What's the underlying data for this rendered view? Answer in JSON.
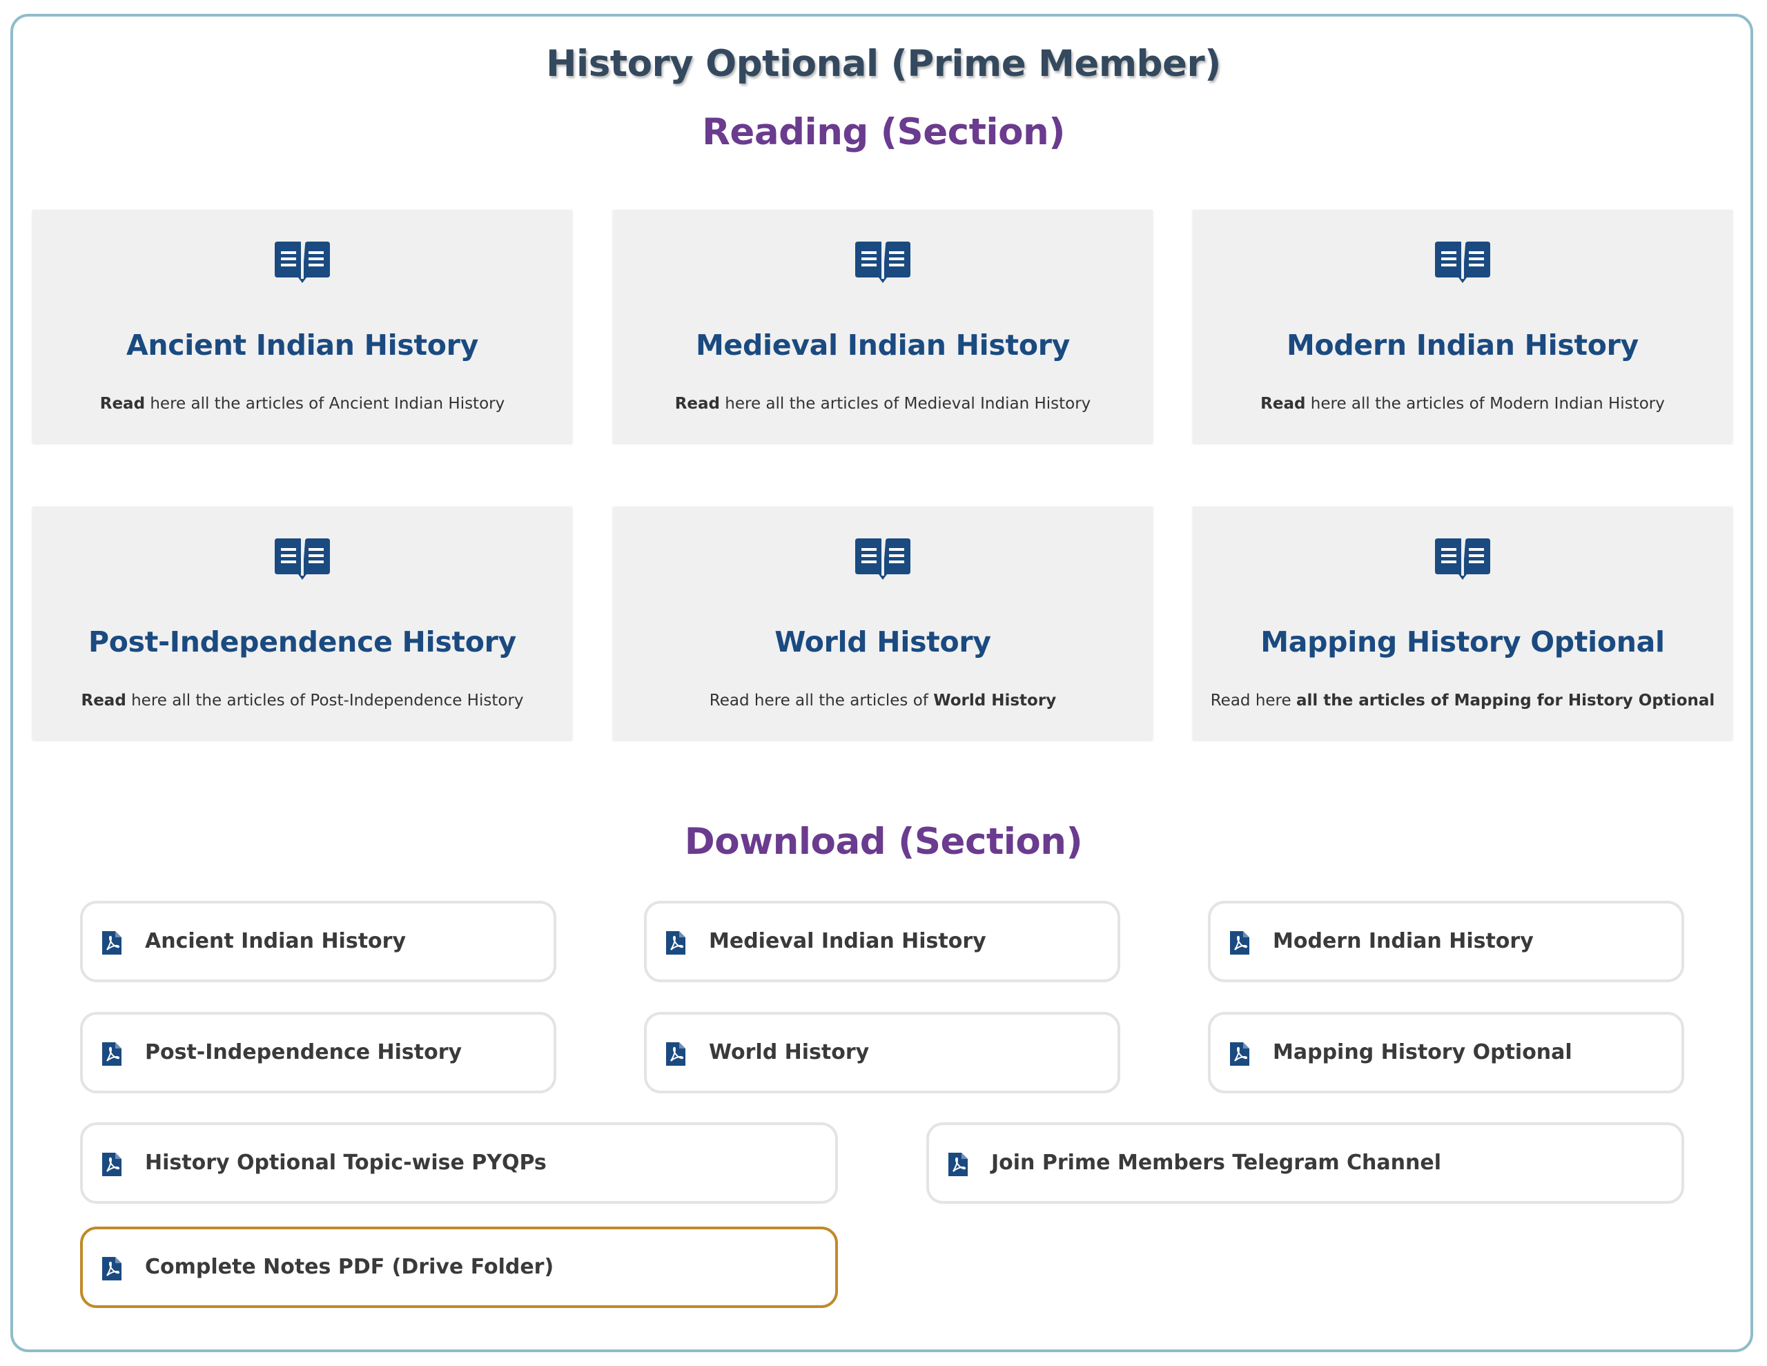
{
  "page": {
    "title": "History Optional (Prime Member)"
  },
  "reading": {
    "title": "Reading (Section)",
    "cards": [
      {
        "title": "Ancient Indian History",
        "desc_pre": "",
        "desc_bold1": "Read",
        "desc_mid": " here all the articles of Ancient Indian History",
        "desc_bold2": "",
        "icon": "book-open-icon"
      },
      {
        "title": "Medieval Indian History",
        "desc_pre": "",
        "desc_bold1": "Read",
        "desc_mid": " here all the articles of Medieval Indian History",
        "desc_bold2": "",
        "icon": "book-open-icon"
      },
      {
        "title": "Modern Indian History",
        "desc_pre": "",
        "desc_bold1": "Read",
        "desc_mid": " here all the articles of Modern Indian History",
        "desc_bold2": "",
        "icon": "book-open-icon"
      },
      {
        "title": "Post-Independence History",
        "desc_pre": "",
        "desc_bold1": "Read",
        "desc_mid": " here all the articles of Post-Independence History",
        "desc_bold2": "",
        "icon": "book-open-icon"
      },
      {
        "title": "World History",
        "desc_pre": "Read here all the articles of ",
        "desc_bold1": "",
        "desc_mid": "",
        "desc_bold2": "World History",
        "icon": "book-open-icon"
      },
      {
        "title": "Mapping History Optional",
        "desc_pre": "Read here ",
        "desc_bold1": "",
        "desc_mid": "",
        "desc_bold2": "all the articles of Mapping for History Optional",
        "icon": "book-open-icon"
      }
    ]
  },
  "download": {
    "title": "Download (Section)",
    "items": [
      {
        "label": "Ancient Indian History",
        "icon": "pdf-file-icon"
      },
      {
        "label": "Medieval Indian History",
        "icon": "pdf-file-icon"
      },
      {
        "label": "Modern Indian History",
        "icon": "pdf-file-icon"
      },
      {
        "label": "Post-Independence History",
        "icon": "pdf-file-icon"
      },
      {
        "label": "World History",
        "icon": "pdf-file-icon"
      },
      {
        "label": "Mapping History Optional",
        "icon": "pdf-file-icon"
      },
      {
        "label": "History Optional Topic-wise PYQPs",
        "icon": "pdf-file-icon"
      },
      {
        "label": "Join Prime Members Telegram Channel",
        "icon": "pdf-file-icon"
      },
      {
        "label": "Complete Notes PDF (Drive Folder)",
        "icon": "pdf-file-icon"
      }
    ]
  },
  "colors": {
    "title": "#34495e",
    "section": "#6a3b8e",
    "card_title": "#1a4a80",
    "icon": "#1a4a80",
    "highlight_border": "#c08a2a",
    "frame_border": "#8fbccb"
  }
}
